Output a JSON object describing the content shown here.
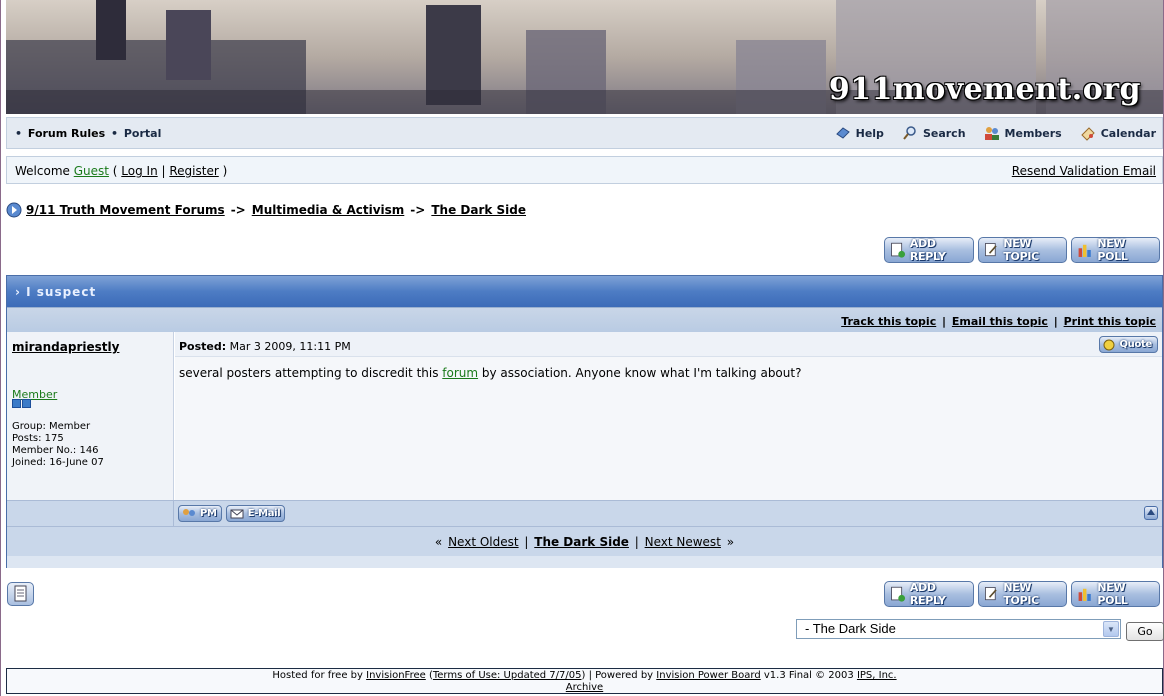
{
  "banner": {
    "site_title": "911movement.org"
  },
  "nav": {
    "left_items": [
      "Forum Rules",
      "Portal"
    ],
    "help": "Help",
    "search": "Search",
    "members": "Members",
    "calendar": "Calendar"
  },
  "userbar": {
    "welcome": "Welcome",
    "guest": "Guest",
    "login": "Log In",
    "register": "Register",
    "resend": "Resend Validation Email"
  },
  "breadcrumb": {
    "items": [
      "9/11 Truth Movement Forums",
      "Multimedia & Activism",
      "The Dark Side"
    ],
    "separator": "->"
  },
  "buttons": {
    "add_reply": "ADD REPLY",
    "new_topic": "NEW TOPIC",
    "new_poll": "NEW POLL",
    "quote": "Quote",
    "pm": "PM",
    "email": "E-Mail",
    "go": "Go"
  },
  "topic": {
    "title": "I suspect",
    "actions": [
      "Track this topic",
      "Email this topic",
      "Print this topic"
    ],
    "nav": {
      "prev": "Next Oldest",
      "forum": "The Dark Side",
      "next": "Next Newest"
    }
  },
  "post": {
    "author": "mirandapriestly",
    "member_title": "Member",
    "member_info": [
      "Group: Member",
      "Posts: 175",
      "Member No.: 146",
      "Joined: 16-June 07"
    ],
    "posted_label": "Posted:",
    "posted_date": "Mar 3 2009, 11:11 PM",
    "body_before": "several posters attempting to discredit this ",
    "body_link": "forum",
    "body_after": " by association. Anyone know what I'm talking about?"
  },
  "jump": {
    "selected": "- The Dark Side"
  },
  "footer": {
    "hosted": "Hosted for free by",
    "invisionfree": "InvisionFree",
    "terms": "Terms of Use: Updated 7/7/05",
    "powered": "Powered by",
    "ipb": "Invision Power Board",
    "version": "v1.3 Final © 2003",
    "ips": "IPS, Inc.",
    "archive": "Archive"
  },
  "colors": {
    "accent": "#4d7cc4",
    "link_green": "#1a7a1a",
    "nav_bg": "#e4eaf2"
  }
}
